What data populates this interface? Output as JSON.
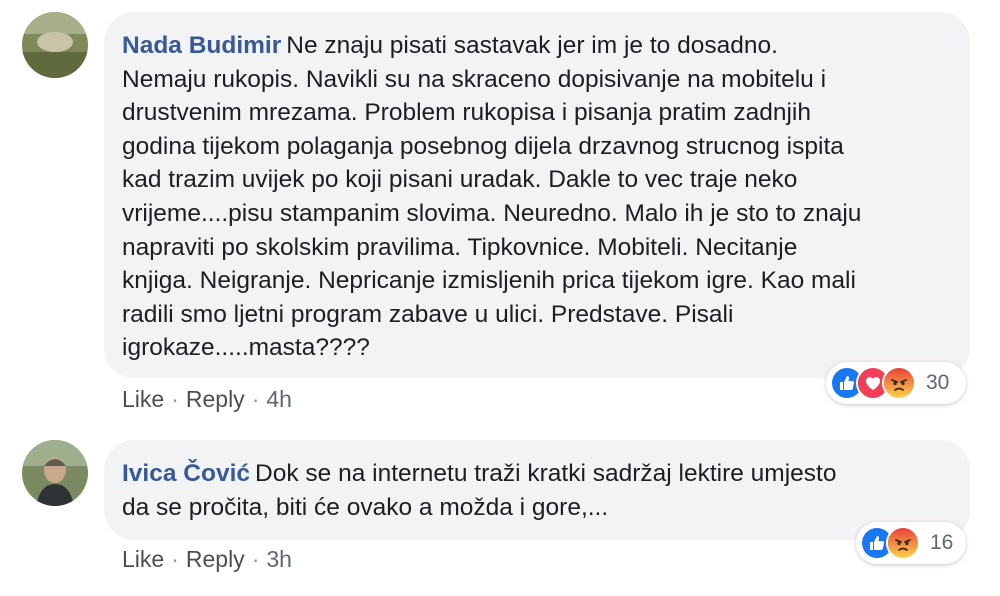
{
  "comments": [
    {
      "author": "Nada Budimir",
      "text": "Ne znaju pisati sastavak jer im je to dosadno.\nNemaju rukopis. Navikli su na skraceno dopisivanje na mobitelu i\ndrustvenim mrezama. Problem rukopisa i pisanja pratim zadnjih\ngodina tijekom polaganja posebnog dijela drzavnog strucnog ispita\nkad trazim uvijek po koji pisani uradak. Dakle to vec traje neko\nvrijeme....pisu stampanim slovima. Neuredno. Malo ih je sto to znaju\nnapraviti po skolskim pravilima. Tipkovnice. Mobiteli. Necitanje\nknjiga. Neigranje. Nepricanje izmisljenih prica tijekom igre. Kao mali\nradili smo ljetni program zabave u ulici. Predstave. Pisali\nigrokaze.....masta????",
      "like_label": "Like",
      "separator": "·",
      "reply_label": "Reply",
      "time": "4h",
      "reactions": [
        "like-icon",
        "love-icon",
        "angry-icon"
      ],
      "reaction_count": "30"
    },
    {
      "author": "Ivica Čović",
      "text": "Dok se na internetu traži kratki sadržaj lektire umjesto\nda se pročita, biti će ovako a možda i gore,...",
      "like_label": "Like",
      "separator": "·",
      "reply_label": "Reply",
      "time": "3h",
      "reactions": [
        "like-icon",
        "angry-icon"
      ],
      "reaction_count": "16"
    }
  ],
  "colors": {
    "author": "#385898",
    "bubble": "#f2f3f5",
    "like": "#1877f2",
    "love": "#f33e58",
    "angry": "#f7714c"
  }
}
